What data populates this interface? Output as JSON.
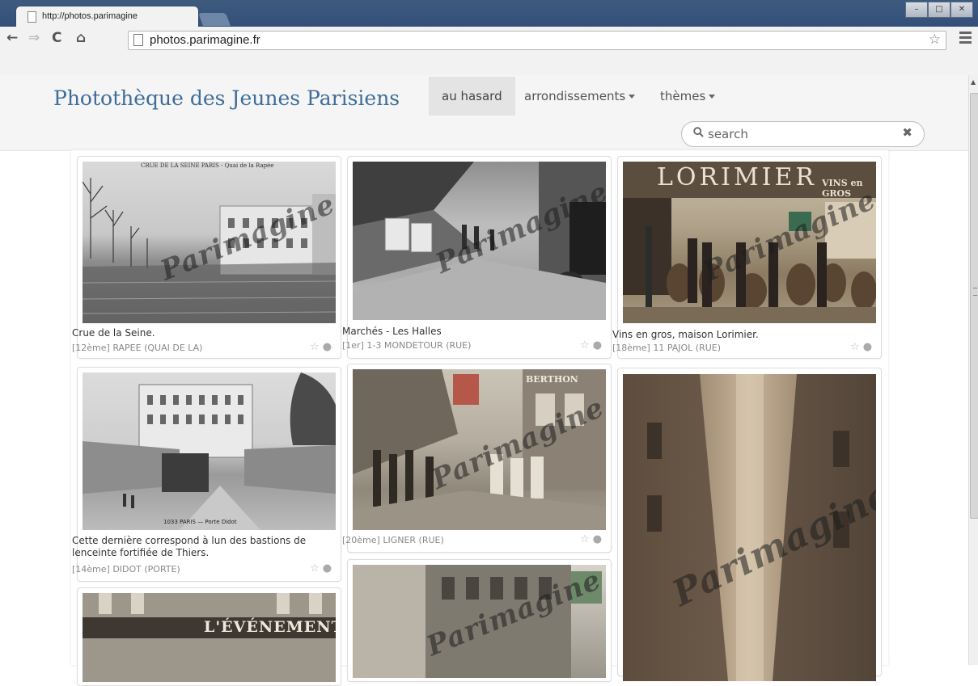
{
  "browser": {
    "tab_title": "http://photos.parimagine",
    "tab_close": "×",
    "url": "photos.parimagine.fr"
  },
  "site": {
    "brand": "Photothèque des Jeunes Parisiens",
    "nav": {
      "random": "au hasard",
      "districts": "arrondissements",
      "themes": "thèmes"
    },
    "search": {
      "placeholder": "search",
      "clear_glyph": "✖"
    },
    "accent_color": "#3e6d99"
  },
  "watermark": "Parimagine",
  "photos": [
    {
      "caption": "Crue de la Seine.",
      "location": "[12ème] RAPEE (QUAI DE LA)"
    },
    {
      "caption": "Marchés - Les Halles",
      "location": "[1er] 1-3 MONDETOUR (RUE)"
    },
    {
      "caption": "Vins en gros, maison Lorimier.",
      "location": "[18ème] 11 PAJOL (RUE)"
    },
    {
      "caption": "Cette dernière correspond à lun des bastions de lenceinte fortifiée de Thiers.",
      "location": "[14ème] DIDOT (PORTE)"
    },
    {
      "caption": "",
      "location": "[20ème] LIGNER (RUE)"
    }
  ],
  "photo_texts": {
    "p1_top": "CRUE DE LA SEINE          PARIS - Quai de la Rapée",
    "p3_sign": "LORIMIER",
    "p3_sign2": "VINS en GROS",
    "p4_bottom": "1033 PARIS — Porte Didot",
    "p5_sign": "BERTHON",
    "p7_sign": "L'ÉVÉNEMENT"
  }
}
